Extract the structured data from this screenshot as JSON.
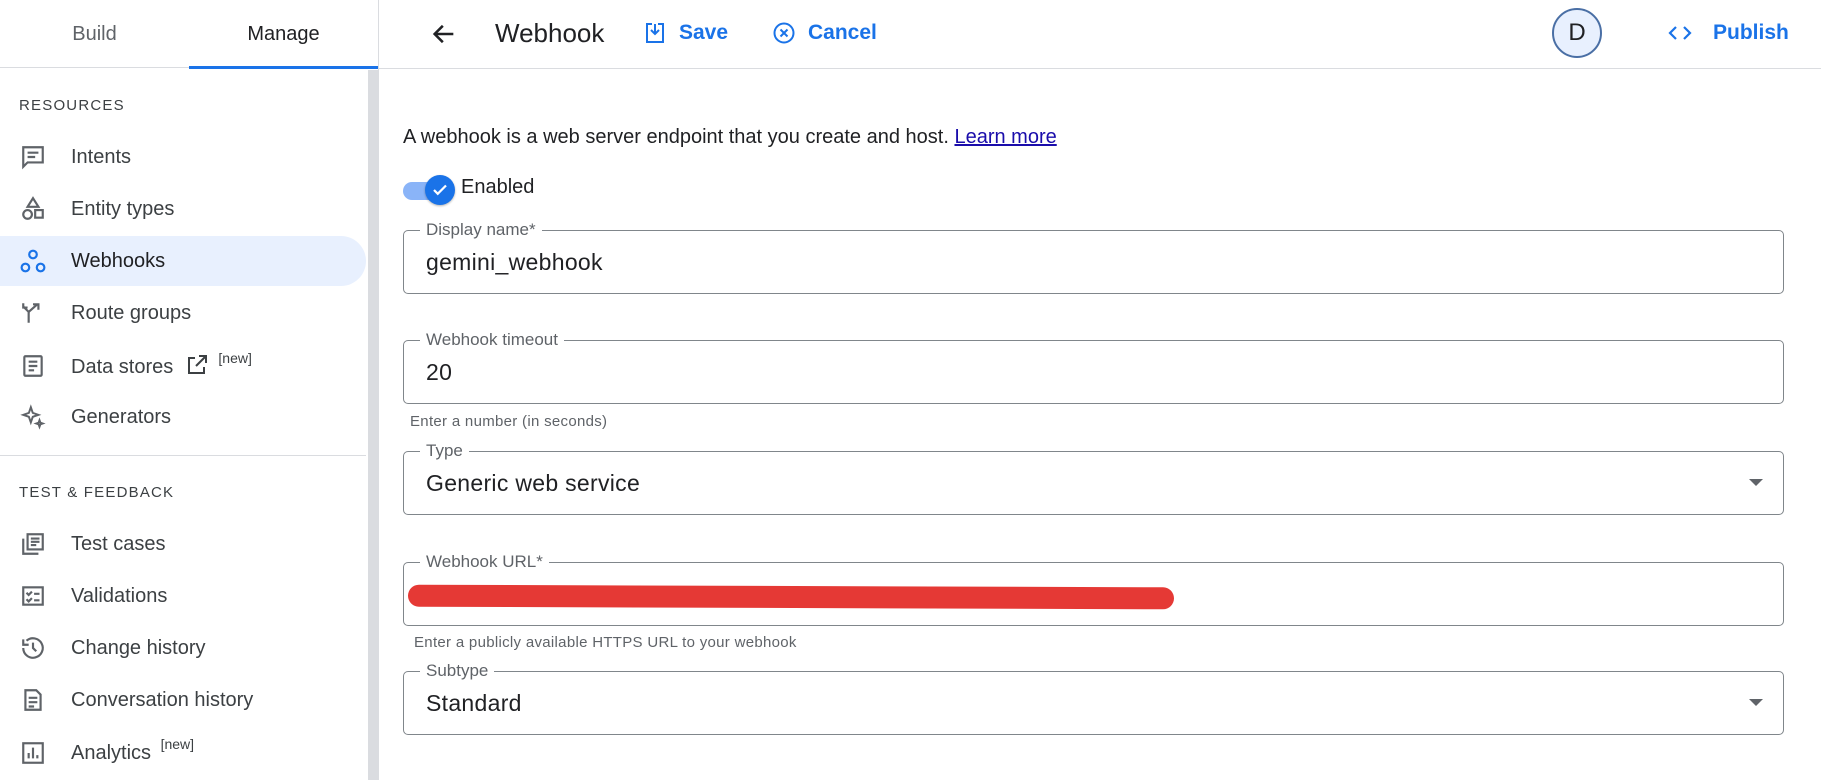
{
  "tabs": {
    "build": "Build",
    "manage": "Manage"
  },
  "sidebar": {
    "resources_title": "RESOURCES",
    "resources": [
      {
        "label": "Intents",
        "icon": "intents-icon"
      },
      {
        "label": "Entity types",
        "icon": "entity-types-icon"
      },
      {
        "label": "Webhooks",
        "icon": "webhooks-icon",
        "active": true
      },
      {
        "label": "Route groups",
        "icon": "route-groups-icon"
      },
      {
        "label": "Data stores",
        "icon": "data-stores-icon",
        "badge": "[new]"
      },
      {
        "label": "Generators",
        "icon": "generators-icon"
      }
    ],
    "test_title": "TEST & FEEDBACK",
    "test": [
      {
        "label": "Test cases",
        "icon": "test-cases-icon"
      },
      {
        "label": "Validations",
        "icon": "validations-icon"
      },
      {
        "label": "Change history",
        "icon": "history-icon"
      },
      {
        "label": "Conversation history",
        "icon": "conversation-history-icon"
      },
      {
        "label": "Analytics",
        "icon": "analytics-icon",
        "badge": "[new]"
      }
    ]
  },
  "topbar": {
    "title": "Webhook",
    "save_label": "Save",
    "cancel_label": "Cancel",
    "avatar_initial": "D",
    "publish_label": "Publish"
  },
  "main": {
    "description": "A webhook is a web server endpoint that you create and host.",
    "learn_more": "Learn more",
    "enabled_label": "Enabled",
    "enabled": true,
    "display_name": {
      "label": "Display name*",
      "value": "gemini_webhook"
    },
    "timeout": {
      "label": "Webhook timeout",
      "value": "20",
      "hint": "Enter a number (in seconds)"
    },
    "type": {
      "label": "Type",
      "value": "Generic web service"
    },
    "url": {
      "label": "Webhook URL*",
      "hint": "Enter a publicly available HTTPS URL to your webhook"
    },
    "subtype": {
      "label": "Subtype",
      "value": "Standard"
    }
  },
  "colors": {
    "accent": "#1a73e8",
    "active_bg": "#e8f0fe",
    "redaction": "#e53935"
  }
}
